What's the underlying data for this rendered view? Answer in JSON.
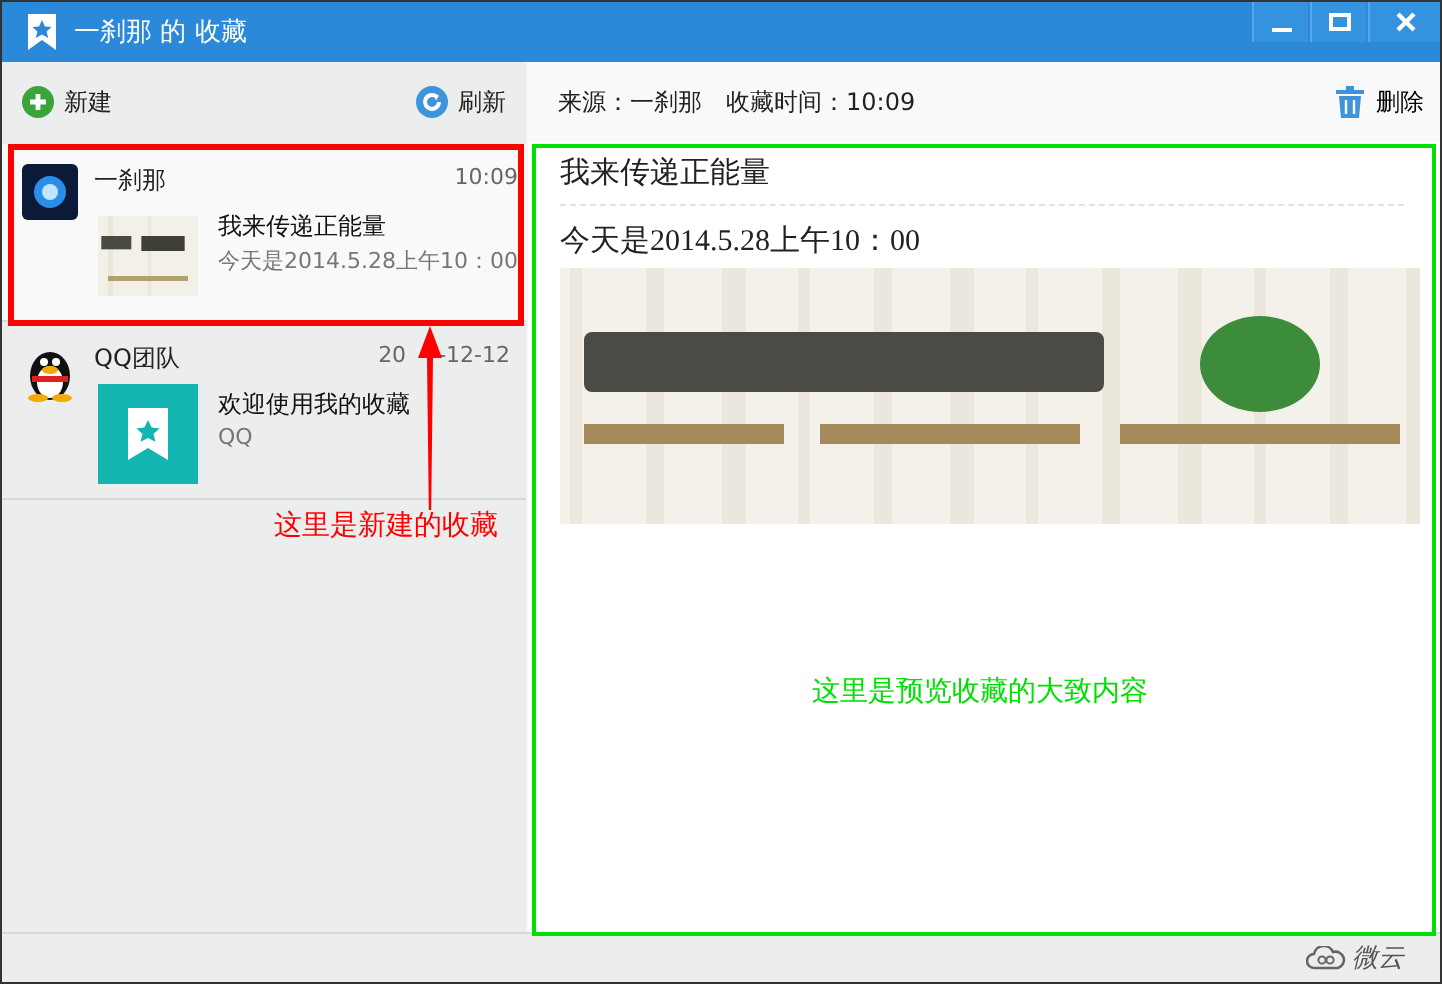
{
  "window": {
    "title": "一刹那 的 收藏"
  },
  "sidebar": {
    "toolbar": [
      {
        "kind": "new",
        "label": "新建"
      },
      {
        "kind": "refresh",
        "label": "刷新"
      }
    ],
    "items": [
      {
        "kind": "user",
        "author": "一刹那",
        "date_parts": [
          "10:09"
        ],
        "title": "我来传递正能量",
        "summary": "今天是2014.5.28上午10：00",
        "selected": true
      },
      {
        "kind": "system",
        "author": "QQ团队",
        "date_parts": [
          "20",
          "-12-12"
        ],
        "title": "欢迎使用我的收藏",
        "summary": "QQ",
        "selected": false
      }
    ]
  },
  "detail": {
    "source": "来源：一刹那",
    "time": "收藏时间：10:09",
    "delete": "删除",
    "title": "我来传递正能量",
    "body": "今天是2014.5.28上午10：00"
  },
  "annotations": [
    {
      "kind": "new",
      "text": "这里是新建的收藏",
      "color": "#ff0000"
    },
    {
      "kind": "preview",
      "text": "这里是预览收藏的大致内容",
      "color": "#00e000"
    }
  ],
  "status_bar": {
    "brand": "微云"
  }
}
